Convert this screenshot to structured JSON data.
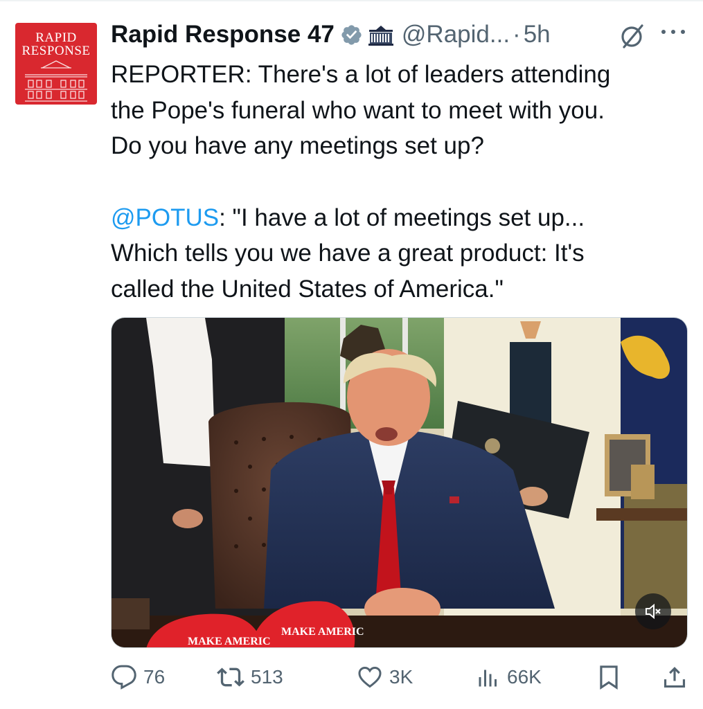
{
  "account": {
    "avatar_line1": "RAPID",
    "avatar_line2": "RESPONSE",
    "display_name": "Rapid Response 47",
    "handle": "@Rapid...",
    "separator": "·",
    "time": "5h",
    "verified_color": "#829aab",
    "avatar_color": "#d9282f"
  },
  "tweet": {
    "line1": "REPORTER: There's a lot of leaders attending",
    "line2": "the Pope's funeral who want to meet with you.",
    "line3": "Do you have any meetings set up?",
    "mention": "@POTUS",
    "quote1": ": \"I have a lot of meetings set up...",
    "quote2": "Which tells you we have a great product: It's",
    "quote3": "called the United States of America.\""
  },
  "media": {
    "hat_text_1": "MAKE AMERIC",
    "hat_text_2": "MAKE AMERIC",
    "mute_icon": "speaker-muted-icon"
  },
  "actions": {
    "replies": "76",
    "reposts": "513",
    "likes": "3K",
    "views": "66K"
  },
  "icons": [
    "verified-badge-icon",
    "government-building-icon",
    "grok-icon",
    "more-icon",
    "reply-icon",
    "repost-icon",
    "like-icon",
    "views-icon",
    "bookmark-icon",
    "share-icon"
  ],
  "colors": {
    "link": "#1d9bf0",
    "secondary_text": "#536471"
  }
}
